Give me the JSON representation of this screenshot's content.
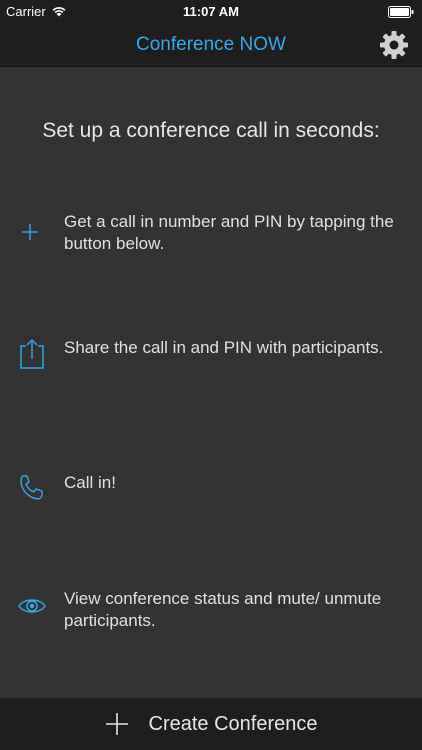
{
  "status_bar": {
    "carrier": "Carrier",
    "time": "11:07 AM",
    "wifi_icon": "wifi-icon",
    "battery_icon": "battery-icon"
  },
  "nav": {
    "title": "Conference NOW",
    "settings_icon": "gear-icon"
  },
  "main": {
    "headline": "Set up a conference call in seconds:",
    "steps": [
      {
        "icon": "plus-icon",
        "text": "Get a call in number and PIN by tapping the button below."
      },
      {
        "icon": "share-icon",
        "text": "Share the call in and PIN with participants."
      },
      {
        "icon": "phone-icon",
        "text": "Call in!"
      },
      {
        "icon": "eye-icon",
        "text": "View conference status and mute/ unmute participants."
      }
    ]
  },
  "bottom": {
    "create_label": "Create Conference",
    "icon": "plus-icon"
  },
  "colors": {
    "accent": "#3aa6e6",
    "background": "#333333",
    "bar": "#1e1e1e",
    "text": "#e0e0e0"
  }
}
